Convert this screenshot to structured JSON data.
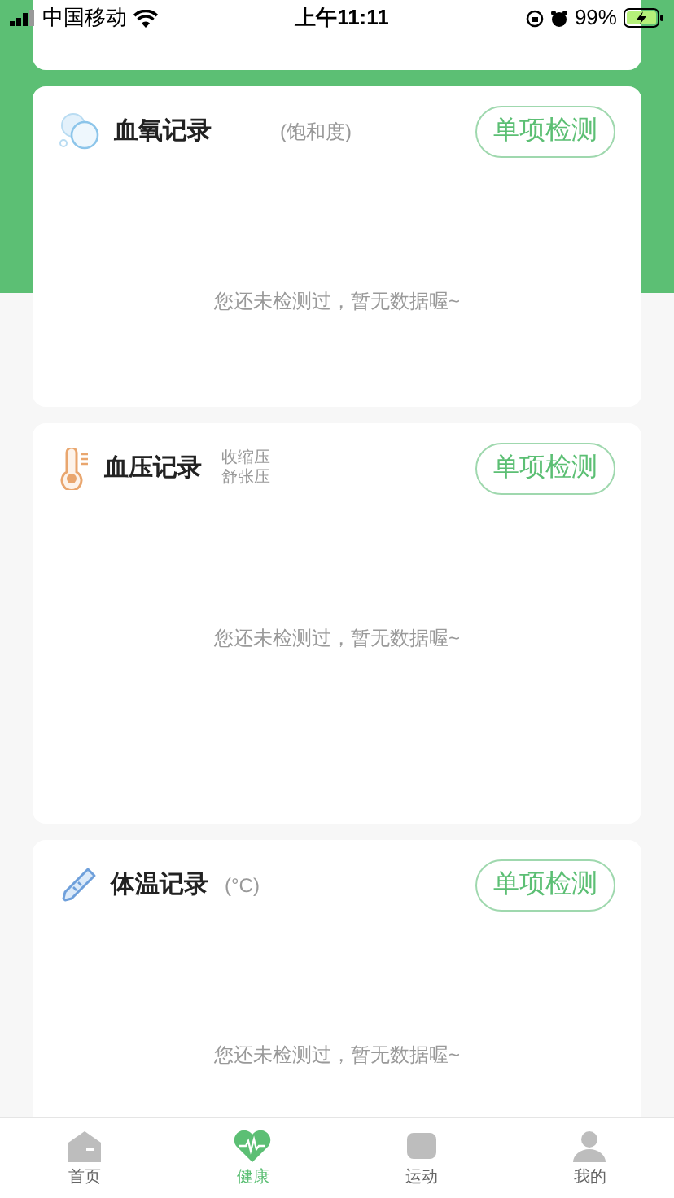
{
  "status_bar": {
    "carrier": "中国移动",
    "time": "上午11:11",
    "battery": "99%"
  },
  "records": [
    {
      "kind": "oxygen",
      "title": "血氧记录",
      "notes": [
        "(饱和度)"
      ],
      "button": "单项检测",
      "empty_text": "您还未检测过，暂无数据喔~"
    },
    {
      "kind": "pressure",
      "title": "血压记录",
      "notes": [
        "收缩压",
        "舒张压"
      ],
      "button": "单项检测",
      "empty_text": "您还未检测过，暂无数据喔~"
    },
    {
      "kind": "temperature",
      "title": "体温记录",
      "notes": [
        "(°C)"
      ],
      "button": "单项检测",
      "empty_text": "您还未检测过，暂无数据喔~"
    }
  ],
  "tab_bar": [
    {
      "kind": "home",
      "label": "首页",
      "selected": false
    },
    {
      "kind": "health",
      "label": "健康",
      "selected": true
    },
    {
      "kind": "sport",
      "label": "运动",
      "selected": false
    },
    {
      "kind": "mine",
      "label": "我的",
      "selected": false
    }
  ]
}
